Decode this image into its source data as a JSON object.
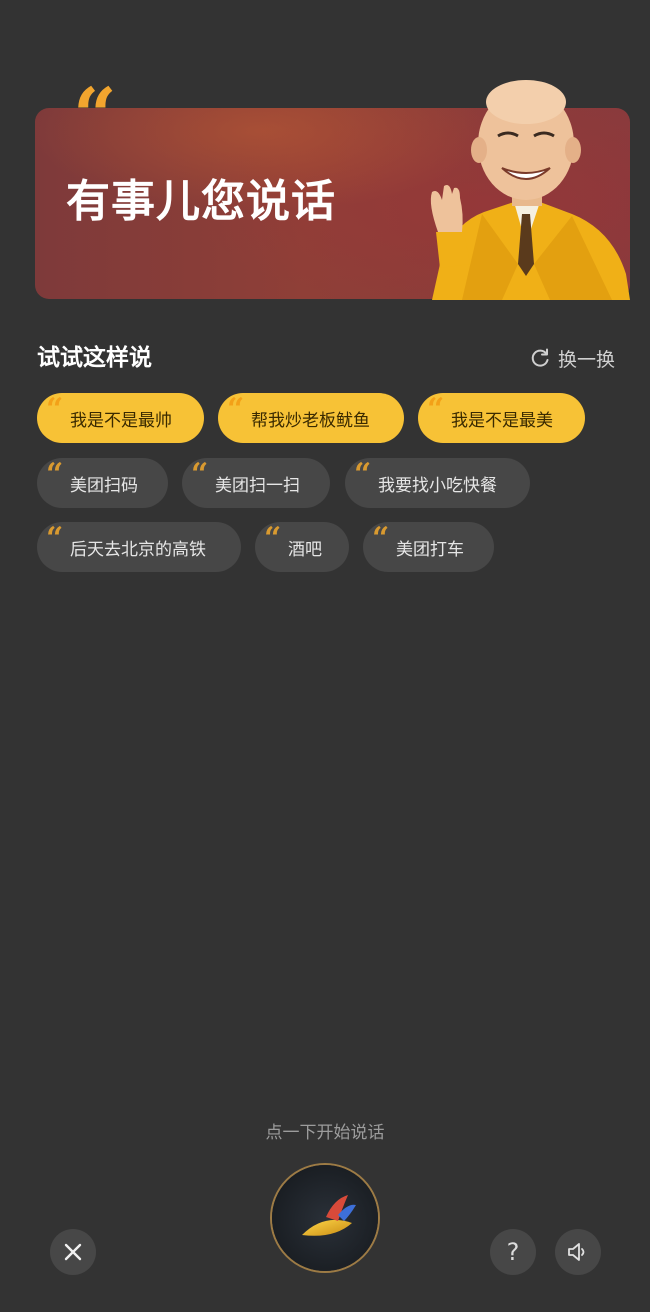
{
  "banner": {
    "quote_glyph": "“",
    "title": "有事儿您说话",
    "mascot": "cartoon-man-in-yellow-suit"
  },
  "suggestions": {
    "title": "试试这样说",
    "refresh_label": "换一换",
    "chips": [
      {
        "text": "我是不是最帅",
        "highlight": true
      },
      {
        "text": "帮我炒老板鱿鱼",
        "highlight": true
      },
      {
        "text": "我是不是最美",
        "highlight": true
      },
      {
        "text": "美团扫码",
        "highlight": false
      },
      {
        "text": "美团扫一扫",
        "highlight": false
      },
      {
        "text": "我要找小吃快餐",
        "highlight": false
      },
      {
        "text": "后天去北京的高铁",
        "highlight": false
      },
      {
        "text": "酒吧",
        "highlight": false
      },
      {
        "text": "美团打车",
        "highlight": false
      }
    ]
  },
  "voice": {
    "hint": "点一下开始说话"
  },
  "controls": {
    "close_icon": "close-icon",
    "help_label": "?",
    "speaker_icon": "speaker-icon"
  },
  "colors": {
    "background": "#333333",
    "accent_yellow": "#f7c236",
    "quote_orange": "#f2a52e",
    "chip_dark": "#474747"
  }
}
